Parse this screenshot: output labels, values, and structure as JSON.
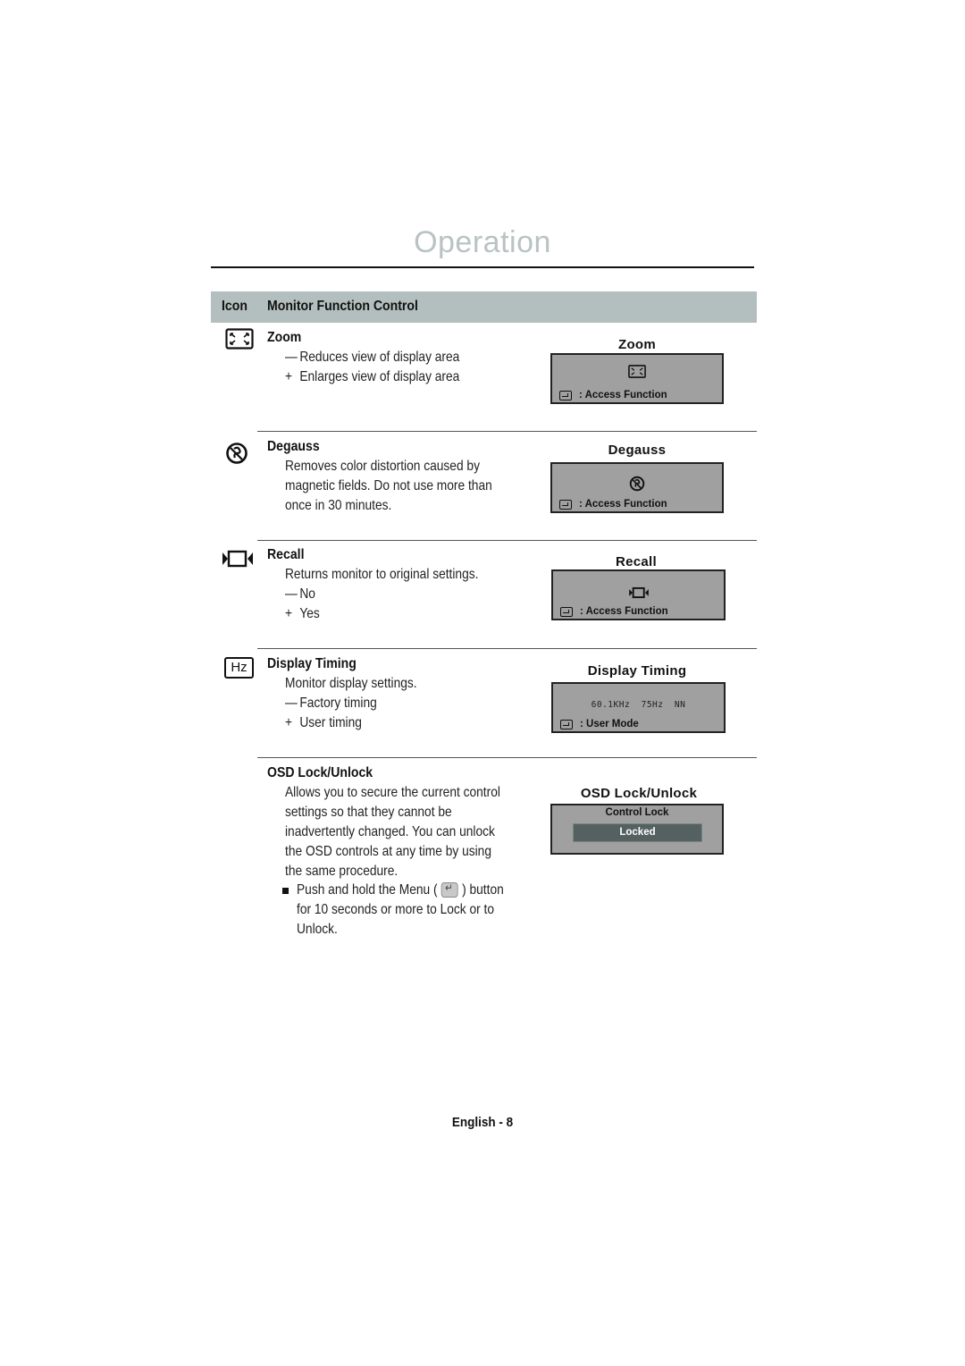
{
  "page": {
    "title": "Operation",
    "footer": "English - 8"
  },
  "table_header": {
    "icon_col": "Icon",
    "function_col": "Monitor Function Control"
  },
  "sections": [
    {
      "icon": "zoom-icon",
      "title": "Zoom",
      "lines": [
        {
          "symbol": "—",
          "text": "Reduces view of display area"
        },
        {
          "symbol": "+",
          "text": "Enlarges view of display area"
        }
      ],
      "osd": {
        "label": "Zoom",
        "footer": ": Access Function"
      }
    },
    {
      "icon": "degauss-icon",
      "title": "Degauss",
      "lines": [
        {
          "symbol": "",
          "text": "Removes color distortion caused by"
        },
        {
          "symbol": "",
          "text": "magnetic fields. Do not use more than"
        },
        {
          "symbol": "",
          "text": "once in 30 minutes."
        }
      ],
      "osd": {
        "label": "Degauss",
        "footer": ": Access Function"
      }
    },
    {
      "icon": "recall-icon",
      "title": "Recall",
      "lines": [
        {
          "symbol": "",
          "text": "Returns monitor to original settings."
        },
        {
          "symbol": "—",
          "text": "No"
        },
        {
          "symbol": "+",
          "text": "Yes"
        }
      ],
      "osd": {
        "label": "Recall",
        "footer": ": Access Function"
      }
    },
    {
      "icon": "hz-icon",
      "icon_text": "Hz",
      "title": "Display Timing",
      "lines": [
        {
          "symbol": "",
          "text": "Monitor display settings."
        },
        {
          "symbol": "—",
          "text": "Factory timing"
        },
        {
          "symbol": "+",
          "text": "User timing"
        }
      ],
      "osd": {
        "label": "Display Timing",
        "timing": "60.1KHz  75Hz  NN",
        "footer": ": User Mode"
      }
    },
    {
      "title": "OSD Lock/Unlock",
      "lines": [
        {
          "symbol": "",
          "text": "Allows you to secure the current control"
        },
        {
          "symbol": "",
          "text": "settings so that they cannot be"
        },
        {
          "symbol": "",
          "text": "inadvertently changed. You can unlock"
        },
        {
          "symbol": "",
          "text": "the OSD controls at any time by using"
        },
        {
          "symbol": "",
          "text": "the same procedure."
        }
      ],
      "bullet": {
        "line1_before": "Push and hold the Menu (",
        "line1_after": ") button",
        "line2": "for 10 seconds or more to Lock or to",
        "line3": "Unlock."
      },
      "osd": {
        "label": "OSD Lock/Unlock",
        "lock_title": "Control Lock",
        "lock_state": "Locked"
      }
    }
  ],
  "colors": {
    "title": "#b9c3c3",
    "header_bar": "#b3bfbe",
    "osd_bg": "#a0a0a0",
    "locked_bg": "#556060"
  }
}
